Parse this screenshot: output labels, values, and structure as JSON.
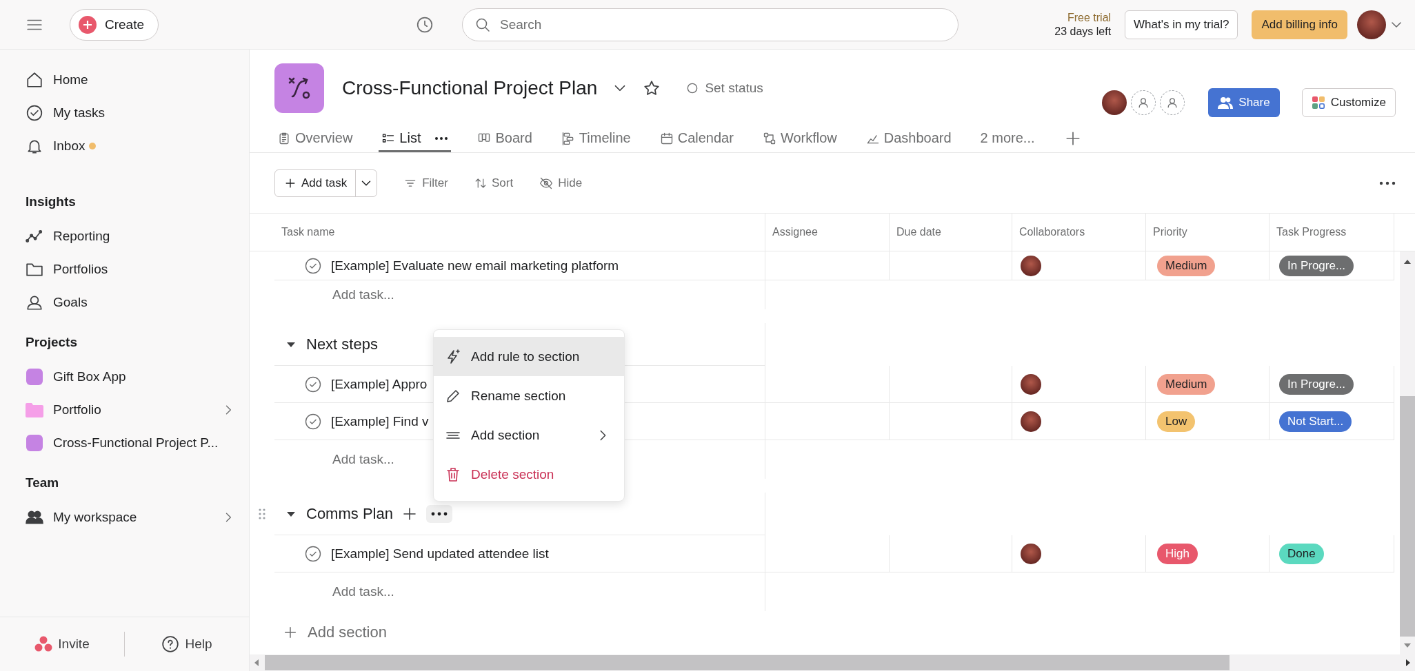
{
  "topbar": {
    "create": "Create",
    "search_placeholder": "Search",
    "trial_label": "Free trial",
    "trial_days": "23 days left",
    "trial_button": "What's in my trial?",
    "billing_button": "Add billing info"
  },
  "sidebar": {
    "nav": [
      {
        "label": "Home",
        "kind": "home",
        "notification": false
      },
      {
        "label": "My tasks",
        "kind": "tasks",
        "notification": false
      },
      {
        "label": "Inbox",
        "kind": "inbox",
        "notification": true
      }
    ],
    "sections": [
      {
        "title": "Insights",
        "items": [
          {
            "label": "Reporting",
            "kind": "reporting",
            "has_children": false
          },
          {
            "label": "Portfolios",
            "kind": "portfolios",
            "has_children": false
          },
          {
            "label": "Goals",
            "kind": "goals",
            "has_children": false
          }
        ]
      },
      {
        "title": "Projects",
        "items": [
          {
            "label": "Gift Box App",
            "kind": "project",
            "color": "#c583e3",
            "has_children": false
          },
          {
            "label": "Portfolio",
            "kind": "folder",
            "color": "#f59fe8",
            "has_children": true
          },
          {
            "label": "Cross-Functional Project P...",
            "kind": "project",
            "color": "#c583e3",
            "has_children": false
          }
        ]
      },
      {
        "title": "Team",
        "items": [
          {
            "label": "My workspace",
            "kind": "team",
            "has_children": true
          }
        ]
      }
    ],
    "footer": {
      "invite": "Invite",
      "help": "Help"
    }
  },
  "header": {
    "title": "Cross-Functional Project Plan",
    "set_status": "Set status",
    "share": "Share",
    "customize": "Customize",
    "tabs": [
      {
        "label": "Overview",
        "kind": "overview",
        "selected": false
      },
      {
        "label": "List",
        "kind": "list",
        "selected": true
      },
      {
        "label": "Board",
        "kind": "board",
        "selected": false
      },
      {
        "label": "Timeline",
        "kind": "timeline",
        "selected": false
      },
      {
        "label": "Calendar",
        "kind": "calendar",
        "selected": false
      },
      {
        "label": "Workflow",
        "kind": "workflow",
        "selected": false
      },
      {
        "label": "Dashboard",
        "kind": "dashboard",
        "selected": false
      }
    ],
    "more_tabs": "2 more..."
  },
  "toolbar": {
    "add_task": "Add task",
    "filter": "Filter",
    "sort": "Sort",
    "hide": "Hide"
  },
  "table": {
    "columns": [
      "Task name",
      "Assignee",
      "Due date",
      "Collaborators",
      "Priority",
      "Task Progress"
    ],
    "groups": [
      {
        "tasks": [
          {
            "name": "[Example] Evaluate new email marketing platform",
            "completed": false,
            "has_collaborator": true,
            "priority": {
              "label": "Medium",
              "color": "#f1a18e"
            },
            "progress": {
              "label": "In Progre...",
              "color": "#6d6e6f"
            }
          }
        ],
        "add_task": "Add task..."
      },
      {
        "title": "Next steps",
        "expanded": true,
        "hovered": false,
        "tasks": [
          {
            "name": "[Example] Appro",
            "completed": false,
            "has_collaborator": true,
            "priority": {
              "label": "Medium",
              "color": "#f1a18e"
            },
            "progress": {
              "label": "In Progre...",
              "color": "#6d6e6f"
            }
          },
          {
            "name": "[Example] Find v",
            "completed": false,
            "has_collaborator": true,
            "priority": {
              "label": "Low",
              "color": "#f3c36f"
            },
            "progress": {
              "label": "Not Start...",
              "color": "#4573d2"
            }
          }
        ],
        "add_task": "Add task..."
      },
      {
        "title": "Comms Plan",
        "expanded": true,
        "hovered": true,
        "tasks": [
          {
            "name": "[Example] Send updated attendee list",
            "completed": false,
            "has_collaborator": true,
            "priority": {
              "label": "High",
              "color": "#e8586c"
            },
            "progress": {
              "label": "Done",
              "color": "#5bd9bf"
            }
          }
        ],
        "add_task": "Add task..."
      }
    ],
    "add_section": "Add section"
  },
  "menu": {
    "items": [
      {
        "label": "Add rule to section",
        "kind": "rule",
        "highlighted": true,
        "submenu": false,
        "danger": false
      },
      {
        "label": "Rename section",
        "kind": "rename",
        "highlighted": false,
        "submenu": false,
        "danger": false
      },
      {
        "label": "Add section",
        "kind": "add",
        "highlighted": false,
        "submenu": true,
        "danger": false
      },
      {
        "label": "Delete section",
        "kind": "delete",
        "highlighted": false,
        "submenu": false,
        "danger": true
      }
    ]
  }
}
